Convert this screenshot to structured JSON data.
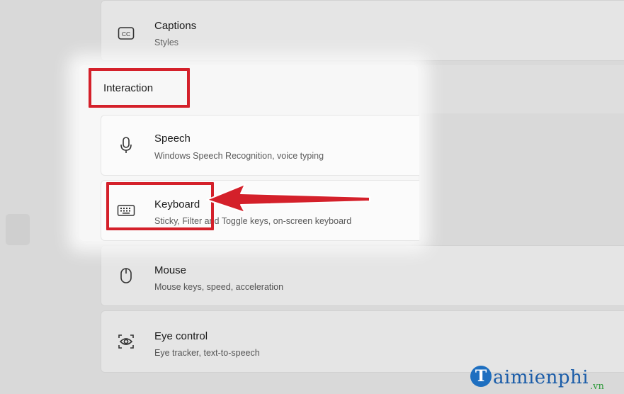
{
  "sections": {
    "interaction_label": "Interaction"
  },
  "items": {
    "captions": {
      "title": "Captions",
      "subtitle": "Styles",
      "icon": "closed-captions-icon"
    },
    "speech": {
      "title": "Speech",
      "subtitle": "Windows Speech Recognition, voice typing",
      "icon": "microphone-icon"
    },
    "keyboard": {
      "title": "Keyboard",
      "subtitle": "Sticky, Filter and Toggle keys, on-screen keyboard",
      "icon": "keyboard-icon"
    },
    "mouse": {
      "title": "Mouse",
      "subtitle": "Mouse keys, speed, acceleration",
      "icon": "mouse-icon"
    },
    "eye_control": {
      "title": "Eye control",
      "subtitle": "Eye tracker, text-to-speech",
      "icon": "eye-control-icon"
    }
  },
  "annotations": {
    "highlight_color": "#d4202a"
  },
  "watermark": {
    "logo_letter": "T",
    "text": "aimienphi",
    "suffix": ".vn"
  }
}
